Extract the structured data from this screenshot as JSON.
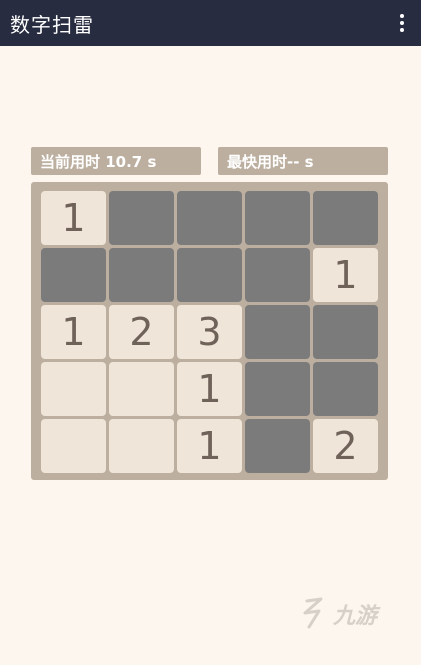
{
  "app": {
    "title": "数字扫雷",
    "menu_icon": "more-vert-icon"
  },
  "stats": {
    "current_time": "当前用时 10.7 s",
    "best_time": "最快用时-- s"
  },
  "board": {
    "rows": 5,
    "cols": 5,
    "cells": [
      [
        "1",
        "",
        "",
        "",
        ""
      ],
      [
        "",
        "",
        "",
        "",
        "1"
      ],
      [
        "1",
        "2",
        "3",
        "",
        ""
      ],
      [
        "",
        "",
        "1",
        "",
        ""
      ],
      [
        "",
        "",
        "1",
        "",
        "2"
      ]
    ],
    "states": [
      [
        "revealed",
        "hidden",
        "hidden",
        "hidden",
        "hidden"
      ],
      [
        "hidden",
        "hidden",
        "hidden",
        "hidden",
        "revealed"
      ],
      [
        "revealed",
        "revealed",
        "revealed",
        "hidden",
        "hidden"
      ],
      [
        "revealed",
        "revealed",
        "revealed",
        "hidden",
        "hidden"
      ],
      [
        "revealed",
        "revealed",
        "revealed",
        "hidden",
        "revealed"
      ]
    ]
  },
  "watermark": {
    "text": "九游"
  },
  "colors": {
    "appbar": "#272c40",
    "background": "#fdf6ef",
    "board": "#bcafa0",
    "hidden_cell": "#7c7b7b",
    "revealed_cell": "#efe6d9",
    "number_text": "#6e6259"
  }
}
